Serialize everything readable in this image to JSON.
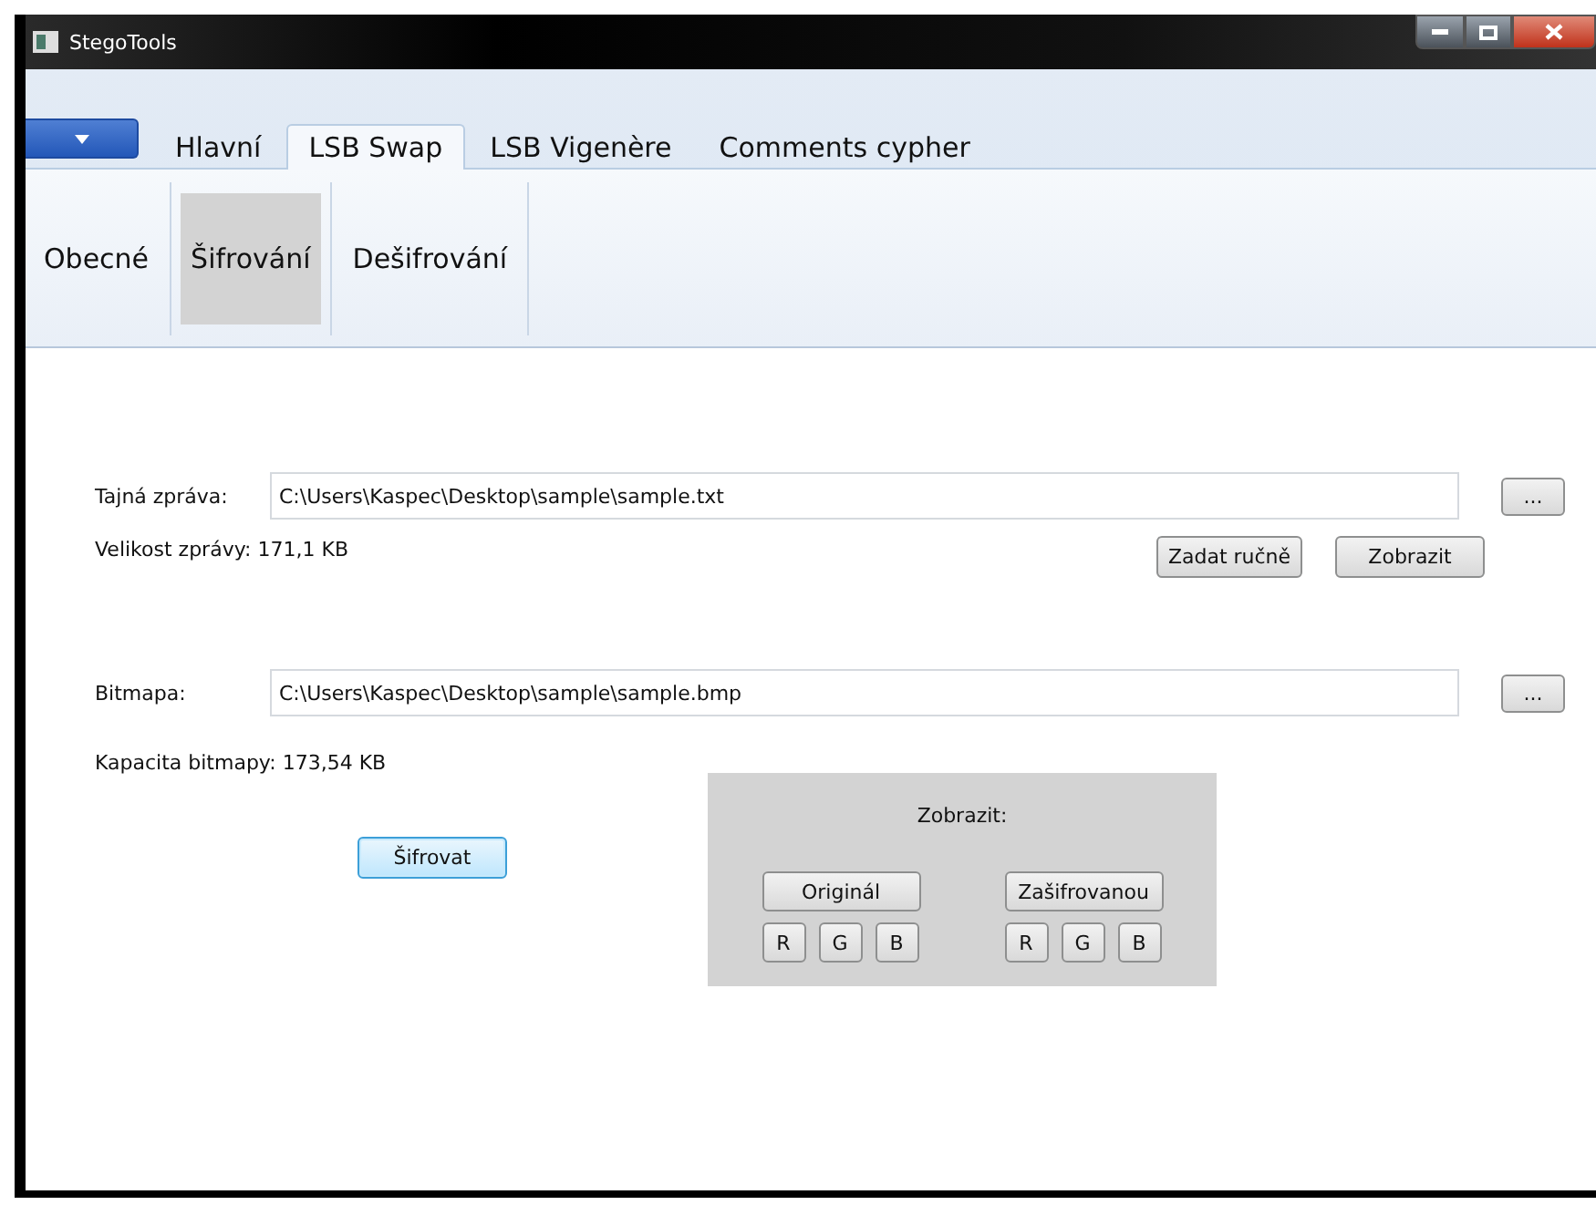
{
  "window": {
    "title": "StegoTools"
  },
  "tabs": [
    {
      "label": "Hlavní",
      "selected": false
    },
    {
      "label": "LSB Swap",
      "selected": true
    },
    {
      "label": "LSB Vigenère",
      "selected": false
    },
    {
      "label": "Comments cypher",
      "selected": false
    }
  ],
  "subtabs": [
    {
      "label": "Obecné",
      "selected": false
    },
    {
      "label": "Šifrování",
      "selected": true
    },
    {
      "label": "Dešifrování",
      "selected": false
    }
  ],
  "message": {
    "label": "Tajná zpráva:",
    "value": "C:\\Users\\Kaspec\\Desktop\\sample\\sample.txt",
    "browse": "...",
    "size": "Velikost zprávy: 171,1 KB",
    "buttons": [
      "Zadat ručně",
      "Zobrazit"
    ]
  },
  "bitmap": {
    "label": "Bitmapa:",
    "value": "C:\\Users\\Kaspec\\Desktop\\sample\\sample.bmp",
    "browse": "...",
    "capacity": "Kapacita bitmapy: 173,54 KB"
  },
  "encrypt_button": {
    "label": "Šifrovat",
    "focused": true
  },
  "preview": {
    "title": "Zobrazit:",
    "groups": [
      {
        "label": "Originál",
        "channels": [
          "R",
          "G",
          "B"
        ]
      },
      {
        "label": "Zašifrovanou",
        "channels": [
          "R",
          "G",
          "B"
        ]
      }
    ]
  }
}
